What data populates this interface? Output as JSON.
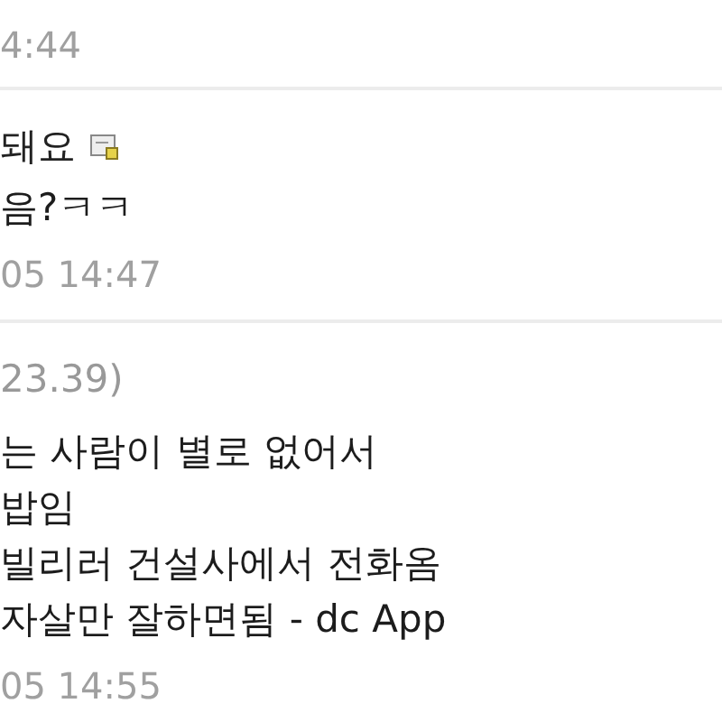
{
  "comments": [
    {
      "date": "4:44"
    },
    {
      "author": "돼요",
      "author_icon": true,
      "lines": [
        "음?ㅋㅋ"
      ],
      "date": "05 14:47"
    },
    {
      "author": "23.39)",
      "author_icon": false,
      "lines": [
        "는 사람이 별로 없어서",
        "밥임",
        "빌리러 건설사에서 전화옴",
        "자살만 잘하면됨 - dc App"
      ],
      "date": "05 14:55"
    }
  ]
}
